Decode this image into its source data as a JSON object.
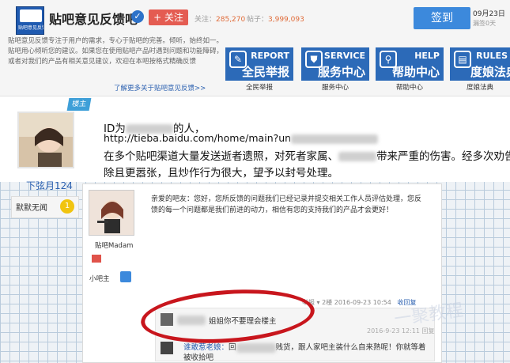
{
  "header": {
    "forum_name": "贴吧意见反馈吧",
    "logo_text": "贴吧意见反馈",
    "follow_label": "+ 关注",
    "followers_label": "关注：",
    "followers": "285,270",
    "posts_label": "帖子：",
    "posts": "3,999,093",
    "signin_label": "签到",
    "date": "09月23日",
    "sign_count": "漏签0天",
    "description": "贴吧意见反馈专注于用户的需求，专心于贴吧的完善。倾听，始终如一。贴吧用心倾听您的建议。如果您在使用贴吧产品时遇到问题和功能障碍，或者对我们的产品有相关意见建议，欢迎在本吧按格式精确反馈",
    "more_link": "了解更多关于贴吧意见反馈>>",
    "cards": [
      {
        "en": "REPORT",
        "cn": "全民举报",
        "sub": "全民举报",
        "icon": "report-icon",
        "glyph": "✎"
      },
      {
        "en": "SERVICE",
        "cn": "服务中心",
        "sub": "服务中心",
        "icon": "shield-icon",
        "glyph": "⛊"
      },
      {
        "en": "HELP",
        "cn": "帮助中心",
        "sub": "帮助中心",
        "icon": "search-icon",
        "glyph": "⚲"
      },
      {
        "en": "RULES",
        "cn": "度娘法典",
        "sub": "度娘法典",
        "icon": "rules-icon",
        "glyph": "▤"
      }
    ]
  },
  "post": {
    "lz_tag": "楼主",
    "username": "下弦月124",
    "rank_text": "默默无闻",
    "rank_level": "1",
    "line1_start": "ID为",
    "line1_end": "的人，",
    "line2": "http://tieba.baidu.com/home/main?un",
    "line3": "在多个贴吧渠道大量发送逝者遗照，对死者家属、",
    "line3_end": "带来严重的伤害。经多次劝告仍不删",
    "line4": "除且更嚣张，且炒作行为很大，望予以封号处理。"
  },
  "reply": {
    "author": "贴吧Madam",
    "role": "小吧主",
    "text": "亲爱的吧友：您好，您所反馈的问题我们已经记录并提交相关工作人员评估处理，您反馈的每一个问题都是我们前进的动力，相信有您的支持我们的产品才会更好！",
    "meta": "举报 ▾  2楼  2016-09-23 10:54",
    "reply_link": "收回复",
    "sub1_text": "姐姐你不要理会楼主",
    "sub1_time": "2016-9-23 12:11  回复",
    "sub2_user": "谁敢惹老娘：",
    "sub2_text": "回",
    "sub2_rest": "贱货，跟人家吧主装什么自来熟呢！你就等着被收拾吧"
  },
  "watermark": "一聚教程"
}
